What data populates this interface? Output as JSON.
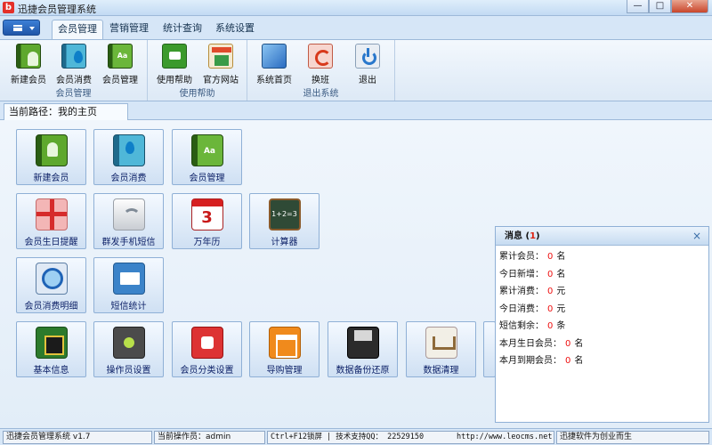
{
  "window": {
    "title": "迅捷会员管理系统",
    "icon_glyph": "b"
  },
  "controls": {
    "minimize": "—",
    "maximize": "□",
    "close": "✕"
  },
  "ribbon": {
    "tabs": [
      {
        "label": "会员管理",
        "active": true
      },
      {
        "label": "营销管理",
        "active": false
      },
      {
        "label": "统计查询",
        "active": false
      },
      {
        "label": "系统设置",
        "active": false
      }
    ],
    "groups": [
      {
        "label": "会员管理",
        "buttons": [
          "新建会员",
          "会员消费",
          "会员管理"
        ]
      },
      {
        "label": "使用帮助",
        "buttons": [
          "使用帮助",
          "官方网站"
        ]
      },
      {
        "label": "退出系统",
        "buttons": [
          "系统首页",
          "换班",
          "退出"
        ]
      }
    ]
  },
  "breadcrumb": {
    "text": "当前路径：我的主页"
  },
  "tiles": [
    {
      "label": "新建会员",
      "icon": "member-book-icon"
    },
    {
      "label": "会员消费",
      "icon": "consume-book-icon"
    },
    {
      "label": "会员管理",
      "icon": "manage-book-icon"
    },
    {
      "label": "会员生日提醒",
      "icon": "gift-icon"
    },
    {
      "label": "群发手机短信",
      "icon": "sms-signal-icon"
    },
    {
      "label": "万年历",
      "icon": "calendar-icon",
      "glyph": "3"
    },
    {
      "label": "计算器",
      "icon": "calculator-icon",
      "glyph": "1+2=3"
    },
    {
      "label": "会员消费明细",
      "icon": "magnifier-icon"
    },
    {
      "label": "短信统计",
      "icon": "mail-icon"
    },
    {
      "label": "基本信息",
      "icon": "chip-icon"
    },
    {
      "label": "操作员设置",
      "icon": "joystick-icon"
    },
    {
      "label": "会员分类设置",
      "icon": "puzzle-icon"
    },
    {
      "label": "导购管理",
      "icon": "org-chart-icon"
    },
    {
      "label": "数据备份还原",
      "icon": "floppy-disk-icon"
    },
    {
      "label": "数据清理",
      "icon": "cart-icon"
    }
  ],
  "messages": {
    "title": "消息",
    "count": "1",
    "close": "×",
    "rows": [
      {
        "label": "累计会员：",
        "value": "0",
        "unit": "名"
      },
      {
        "label": "今日新增：",
        "value": "0",
        "unit": "名"
      },
      {
        "label": "累计消费：",
        "value": "0",
        "unit": "元"
      },
      {
        "label": "今日消费：",
        "value": "0",
        "unit": "元"
      },
      {
        "label": "短信剩余：",
        "value": "0",
        "unit": "条"
      },
      {
        "label": "本月生日会员：",
        "value": "0",
        "unit": "名"
      },
      {
        "label": "本月到期会员：",
        "value": "0",
        "unit": "名"
      }
    ]
  },
  "status": {
    "app": "迅捷会员管理系统 v1.7",
    "operator": "当前操作员：admin",
    "support": "Ctrl+F12锁屏 | 技术支持QQ： 22529150",
    "url": "http://www.leocms.net",
    "slogan": "迅捷软件为创业而生"
  }
}
